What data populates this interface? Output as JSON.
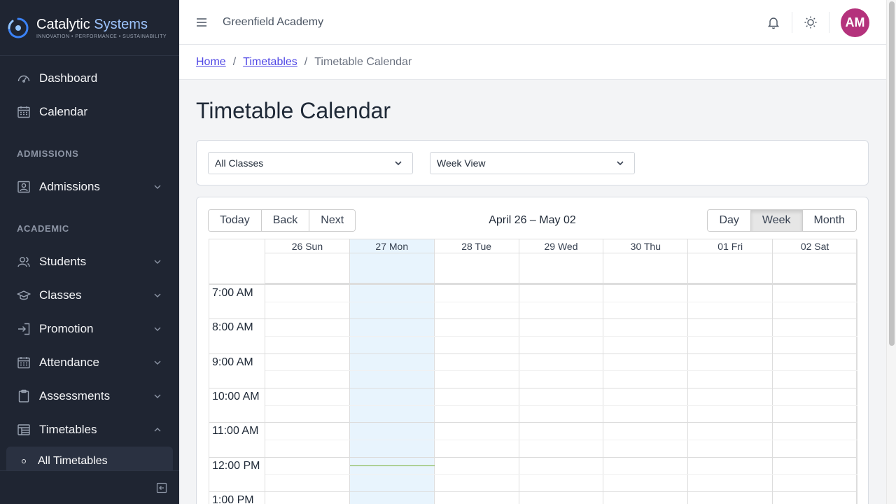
{
  "brand": {
    "name_part1": "Catalytic",
    "name_part2": "Systems",
    "tagline": "INNOVATION • PERFORMANCE • SUSTAINABILITY"
  },
  "sidebar": {
    "items_top": [
      {
        "label": "Dashboard",
        "icon": "gauge-icon"
      },
      {
        "label": "Calendar",
        "icon": "calendar-icon"
      }
    ],
    "section_admissions": "ADMISSIONS",
    "admissions": {
      "label": "Admissions",
      "icon": "id-card-icon"
    },
    "section_academic": "ACADEMIC",
    "academic_items": [
      {
        "label": "Students",
        "icon": "users-icon"
      },
      {
        "label": "Classes",
        "icon": "mortarboard-icon"
      },
      {
        "label": "Promotion",
        "icon": "login-arrow-icon"
      },
      {
        "label": "Attendance",
        "icon": "calendar-icon"
      },
      {
        "label": "Assessments",
        "icon": "clipboard-icon"
      },
      {
        "label": "Timetables",
        "icon": "table-icon"
      }
    ],
    "sub_active": "All Timetables"
  },
  "topbar": {
    "org_name": "Greenfield Academy",
    "avatar_initials": "AM",
    "avatar_color": "#b4327c"
  },
  "breadcrumb": {
    "home": "Home",
    "timetables": "Timetables",
    "current": "Timetable Calendar",
    "separator": "/"
  },
  "page": {
    "title": "Timetable Calendar"
  },
  "filters": {
    "class_select": "All Classes",
    "view_select": "Week View"
  },
  "calendar": {
    "nav_buttons": [
      "Today",
      "Back",
      "Next"
    ],
    "range_label": "April 26 – May 02",
    "view_buttons": [
      "Day",
      "Week",
      "Month"
    ],
    "active_view": "Week",
    "days": [
      "26 Sun",
      "27 Mon",
      "28 Tue",
      "29 Wed",
      "30 Thu",
      "01 Fri",
      "02 Sat"
    ],
    "today_index": 1,
    "times": [
      "7:00 AM",
      "8:00 AM",
      "9:00 AM",
      "10:00 AM",
      "11:00 AM",
      "12:00 PM",
      "1:00 PM"
    ],
    "today_color": "#e8f4fd",
    "now_indicator_color": "#74ad31"
  }
}
